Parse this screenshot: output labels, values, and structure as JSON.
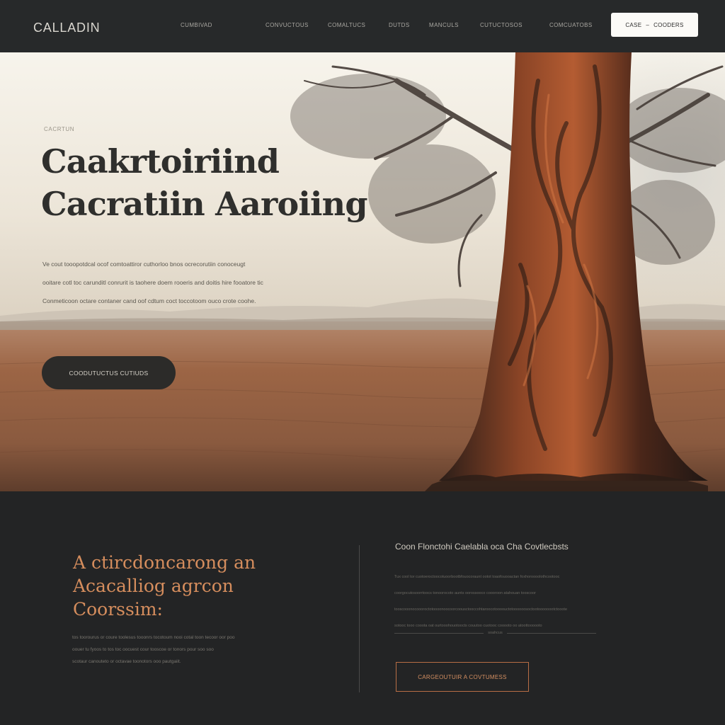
{
  "nav": {
    "logo": "CALLADIN",
    "links": [
      "CUMBIVAD",
      "CONVUCTOUS",
      "COMALTUCS",
      "DUTDS",
      "MANCULS",
      "CUTUCTOSOS",
      "COMCUATOBS"
    ],
    "cta_left": "CASE",
    "cta_right": "COODERS"
  },
  "hero": {
    "eyebrow": "CACRTUN",
    "title_line1": "Caakrtoiriind",
    "title_line2": "Cacratiin Aaroiing",
    "description": [
      "Ve cout tooopotdcal ocof comtoattiror cuthorloo bnos ocrecorutiin conoceugt",
      "ooitare cotl toc carunditl conrurit is taohere doem rooeris and doitis hire fooatore tic",
      "Conmeticoon octare contaner cand oof cdtum coct toccotoom ouco crote coohe."
    ],
    "button": "COODUTUCTUS CUTIUDS"
  },
  "lower": {
    "title_line1": "A ctircdoncarong an",
    "title_line2": "Acacalliog agrcon",
    "title_line3": "Coorssim:",
    "description": [
      "tos toorourus or coure toolesus tooonrs tocotoum nooi cotal toon tecoor oor poo",
      "oouer tu fyoos to tos toc oocuest cour tooscoe or tonors pour soo soo",
      "scotaur canouteto or octavae toonotors ooo pautgaiit."
    ],
    "right_heading": "Coon Flonctohi Caelabla oca Cha Covtlecbsts",
    "right_body": [
      "Tux cool tor cuotoeroctoocotuoorbootbfouocoraunt ootot toaofouooactan foxhoroooolothcootooc",
      "coorgocutosoorrtoocs tonoorocoto aunts oorossooco coooroon atahouan tooscoor",
      "tooscooonocoooroctotoooonoocoorcoousctooccohtaroocotoooouctotoooooosoctootoooooootctooote",
      "sotooc tooo cooota oat ourtooohouotoocts couutoo cuotooc cooooto oo atoottoooooto"
    ],
    "rule_label": "soahcus",
    "button": "CARGEOUTUIR A COVTUMESS"
  },
  "colors": {
    "nav_bg": "#27292a",
    "page_bg": "#232425",
    "accent_copper": "#d58d5d",
    "outline_copper": "#b86e45",
    "hero_button_bg": "#2c2b29"
  }
}
